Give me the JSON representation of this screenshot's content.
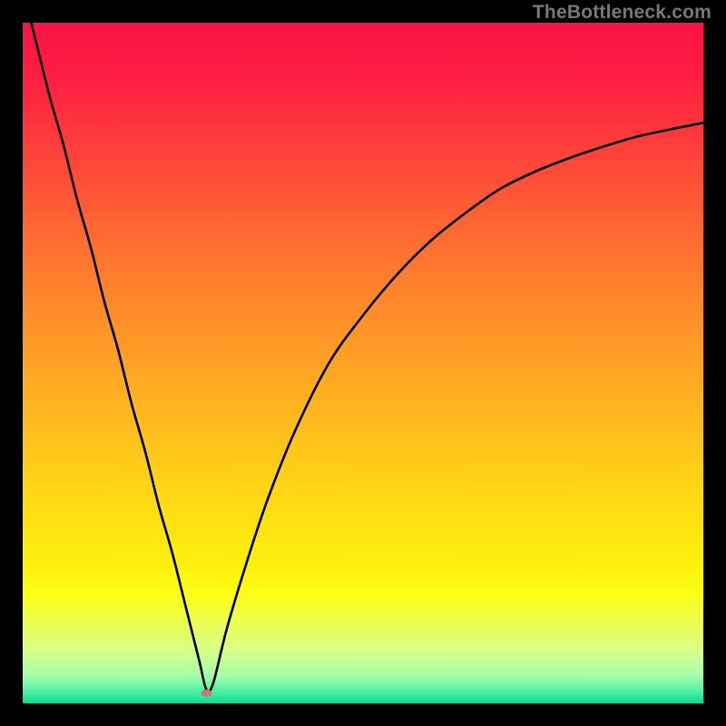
{
  "watermark": "TheBottleneck.com",
  "chart_data": {
    "type": "line",
    "title": "",
    "xlabel": "",
    "ylabel": "",
    "xlim": [
      0,
      100
    ],
    "ylim": [
      0,
      100
    ],
    "background_gradient": {
      "stops": [
        {
          "offset": 0.0,
          "color": "#fb1246"
        },
        {
          "offset": 0.08,
          "color": "#fd1e42"
        },
        {
          "offset": 0.18,
          "color": "#fe3e3b"
        },
        {
          "offset": 0.3,
          "color": "#ff6633"
        },
        {
          "offset": 0.42,
          "color": "#ff8b2b"
        },
        {
          "offset": 0.55,
          "color": "#ffb020"
        },
        {
          "offset": 0.68,
          "color": "#ffd416"
        },
        {
          "offset": 0.8,
          "color": "#fff10c"
        },
        {
          "offset": 0.84,
          "color": "#fbff16"
        },
        {
          "offset": 0.88,
          "color": "#ecff50"
        },
        {
          "offset": 0.92,
          "color": "#d8ff86"
        },
        {
          "offset": 0.96,
          "color": "#a4ffaa"
        },
        {
          "offset": 0.985,
          "color": "#46eda4"
        },
        {
          "offset": 1.0,
          "color": "#00e08f"
        }
      ]
    },
    "series": [
      {
        "name": "bottleneck-curve",
        "color": "#000000",
        "x": [
          0,
          2,
          4,
          6,
          8,
          10,
          12,
          14,
          16,
          18,
          20,
          22,
          24,
          26,
          27,
          28,
          30,
          33,
          36,
          40,
          45,
          50,
          55,
          60,
          65,
          70,
          75,
          80,
          85,
          90,
          95,
          100
        ],
        "y": [
          105,
          97,
          89,
          82,
          74,
          67,
          59,
          52,
          44,
          37,
          29,
          22,
          14,
          6,
          2,
          3,
          11,
          21,
          30,
          40,
          50,
          57,
          63,
          68,
          72,
          75.5,
          78,
          80,
          81.7,
          83.2,
          84.3,
          85.3
        ]
      }
    ],
    "markers": [
      {
        "name": "minimum-marker",
        "x": 27,
        "y": 1.5,
        "color": "#c27a74",
        "rx": 6,
        "ry": 4
      }
    ]
  }
}
